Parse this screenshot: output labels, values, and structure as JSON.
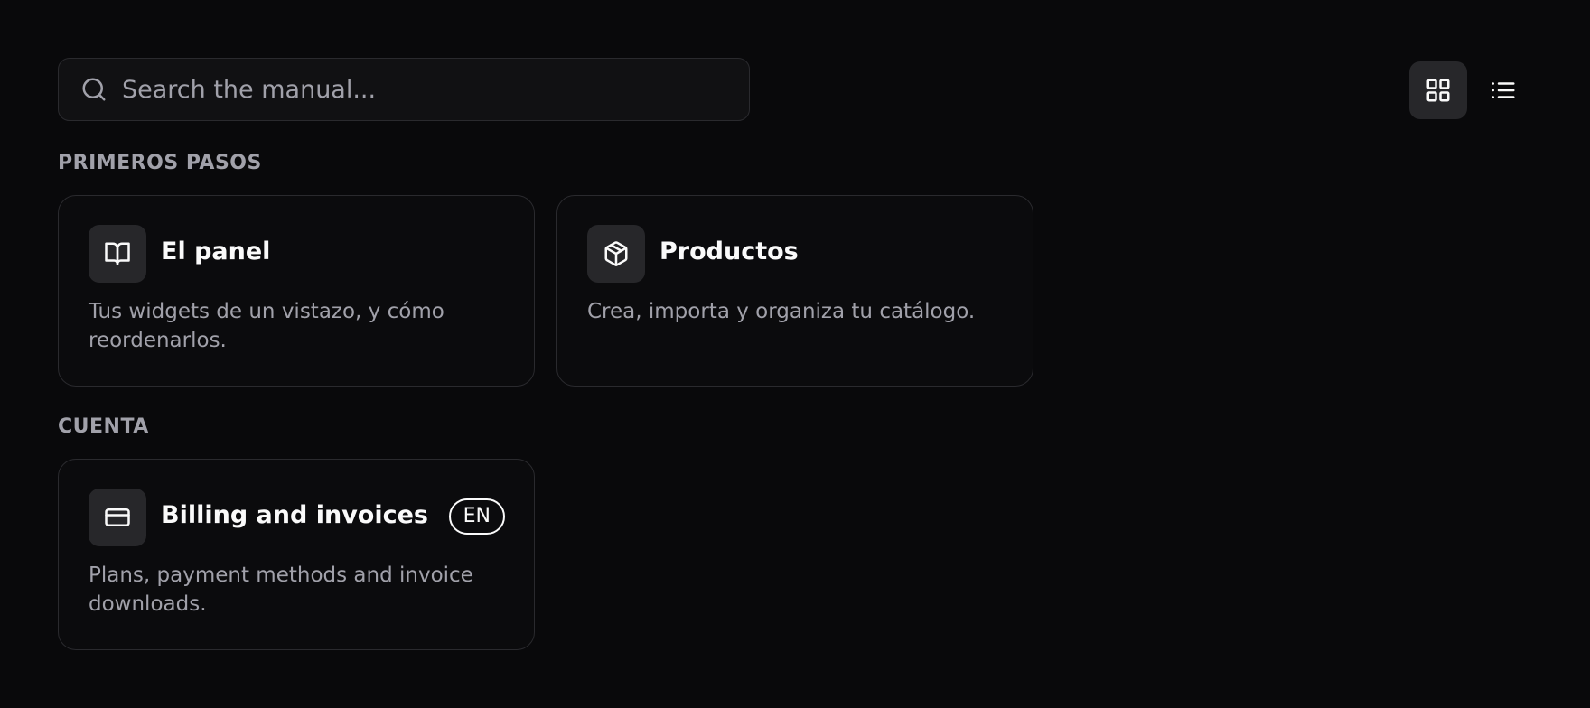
{
  "search": {
    "placeholder": "Search the manual...",
    "value": ""
  },
  "view_toggle": {
    "active": "grid",
    "grid_icon": "grid-icon",
    "list_icon": "list-icon"
  },
  "sections": [
    {
      "title": "PRIMEROS PASOS",
      "cards": [
        {
          "icon": "book-open-icon",
          "title": "El panel",
          "description": "Tus widgets de un vistazo, y cómo reordenarlos."
        },
        {
          "icon": "package-icon",
          "title": "Productos",
          "description": "Crea, importa y organiza tu catálogo."
        }
      ]
    },
    {
      "title": "CUENTA",
      "cards": [
        {
          "icon": "credit-card-icon",
          "title": "Billing and invoices",
          "badge": "EN",
          "description": "Plans, payment methods and invoice downloads."
        }
      ]
    }
  ],
  "colors": {
    "background": "#09090b",
    "card_border": "#2a2a2e",
    "muted_text": "#a1a1aa",
    "icon_tile": "#27272a",
    "foreground": "#fafafa"
  }
}
